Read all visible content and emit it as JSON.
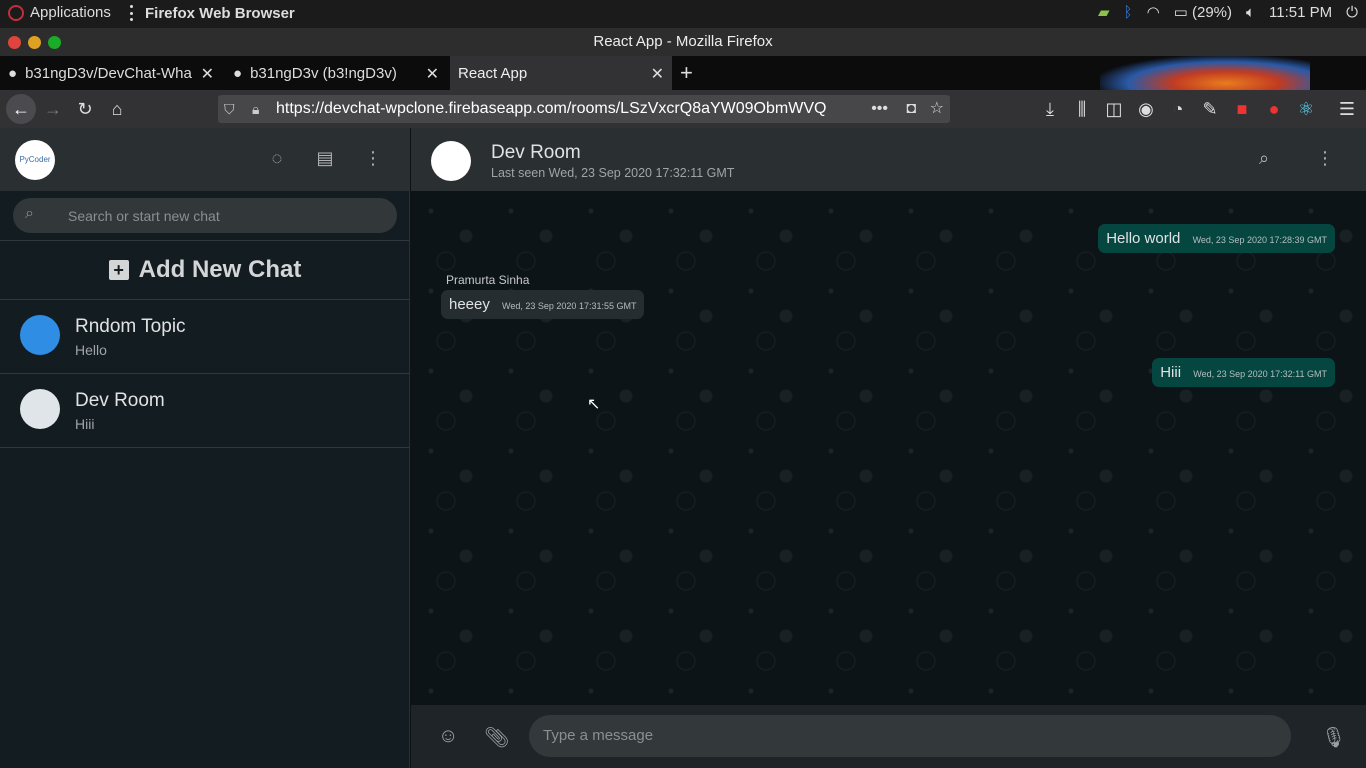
{
  "system": {
    "applications": "Applications",
    "active_app": "Firefox Web Browser",
    "battery": "(29%)",
    "time": "11:51 PM"
  },
  "window": {
    "title": "React App - Mozilla Firefox"
  },
  "tabs": [
    {
      "label": "b31ngD3v/DevChat-Wha"
    },
    {
      "label": "b31ngD3v (b3!ngD3v)"
    },
    {
      "label": "React App"
    }
  ],
  "browser": {
    "url": "https://devchat-wpclone.firebaseapp.com/rooms/LSzVxcrQ8aYW09ObmWVQ"
  },
  "sidebar": {
    "avatar_text": "PyCoder",
    "search_placeholder": "Search or start new chat",
    "add_new_chat": "Add New Chat",
    "chats": [
      {
        "name": "Rndom Topic",
        "last": "Hello"
      },
      {
        "name": "Dev Room",
        "last": "Hiii"
      }
    ]
  },
  "room": {
    "name": "Dev Room",
    "last_seen": "Last seen Wed, 23 Sep 2020 17:32:11 GMT",
    "messages": [
      {
        "text": "Hello world",
        "time": "Wed, 23 Sep 2020 17:28:39 GMT"
      },
      {
        "sender": "Pramurta Sinha",
        "text": "heeey",
        "time": "Wed, 23 Sep 2020 17:31:55 GMT"
      },
      {
        "text": "Hiii",
        "time": "Wed, 23 Sep 2020 17:32:11 GMT"
      }
    ],
    "input_placeholder": "Type a message"
  },
  "colors": {
    "accent": "#054740",
    "incoming": "#262d31",
    "background": "#0d1418"
  }
}
